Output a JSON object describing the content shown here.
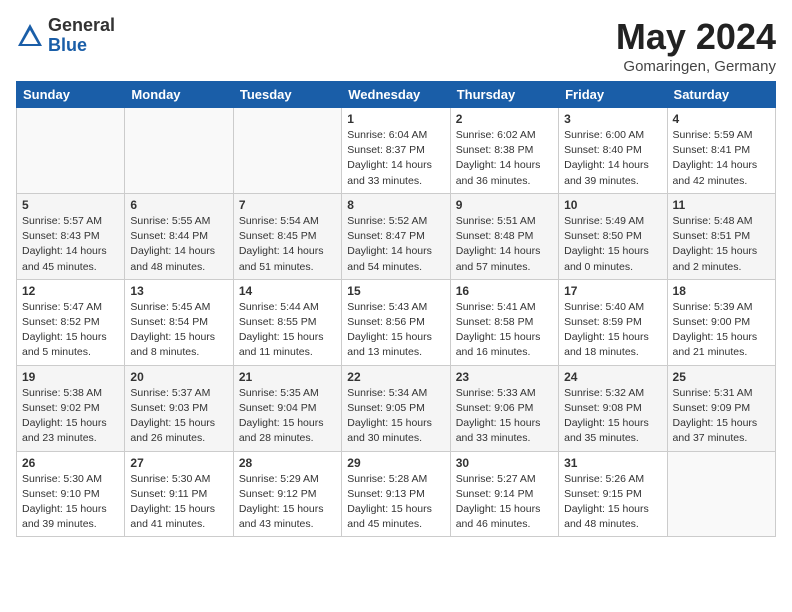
{
  "logo": {
    "general": "General",
    "blue": "Blue"
  },
  "title": "May 2024",
  "subtitle": "Gomaringen, Germany",
  "weekdays": [
    "Sunday",
    "Monday",
    "Tuesday",
    "Wednesday",
    "Thursday",
    "Friday",
    "Saturday"
  ],
  "weeks": [
    [
      {
        "day": "",
        "info": ""
      },
      {
        "day": "",
        "info": ""
      },
      {
        "day": "",
        "info": ""
      },
      {
        "day": "1",
        "info": "Sunrise: 6:04 AM\nSunset: 8:37 PM\nDaylight: 14 hours\nand 33 minutes."
      },
      {
        "day": "2",
        "info": "Sunrise: 6:02 AM\nSunset: 8:38 PM\nDaylight: 14 hours\nand 36 minutes."
      },
      {
        "day": "3",
        "info": "Sunrise: 6:00 AM\nSunset: 8:40 PM\nDaylight: 14 hours\nand 39 minutes."
      },
      {
        "day": "4",
        "info": "Sunrise: 5:59 AM\nSunset: 8:41 PM\nDaylight: 14 hours\nand 42 minutes."
      }
    ],
    [
      {
        "day": "5",
        "info": "Sunrise: 5:57 AM\nSunset: 8:43 PM\nDaylight: 14 hours\nand 45 minutes."
      },
      {
        "day": "6",
        "info": "Sunrise: 5:55 AM\nSunset: 8:44 PM\nDaylight: 14 hours\nand 48 minutes."
      },
      {
        "day": "7",
        "info": "Sunrise: 5:54 AM\nSunset: 8:45 PM\nDaylight: 14 hours\nand 51 minutes."
      },
      {
        "day": "8",
        "info": "Sunrise: 5:52 AM\nSunset: 8:47 PM\nDaylight: 14 hours\nand 54 minutes."
      },
      {
        "day": "9",
        "info": "Sunrise: 5:51 AM\nSunset: 8:48 PM\nDaylight: 14 hours\nand 57 minutes."
      },
      {
        "day": "10",
        "info": "Sunrise: 5:49 AM\nSunset: 8:50 PM\nDaylight: 15 hours\nand 0 minutes."
      },
      {
        "day": "11",
        "info": "Sunrise: 5:48 AM\nSunset: 8:51 PM\nDaylight: 15 hours\nand 2 minutes."
      }
    ],
    [
      {
        "day": "12",
        "info": "Sunrise: 5:47 AM\nSunset: 8:52 PM\nDaylight: 15 hours\nand 5 minutes."
      },
      {
        "day": "13",
        "info": "Sunrise: 5:45 AM\nSunset: 8:54 PM\nDaylight: 15 hours\nand 8 minutes."
      },
      {
        "day": "14",
        "info": "Sunrise: 5:44 AM\nSunset: 8:55 PM\nDaylight: 15 hours\nand 11 minutes."
      },
      {
        "day": "15",
        "info": "Sunrise: 5:43 AM\nSunset: 8:56 PM\nDaylight: 15 hours\nand 13 minutes."
      },
      {
        "day": "16",
        "info": "Sunrise: 5:41 AM\nSunset: 8:58 PM\nDaylight: 15 hours\nand 16 minutes."
      },
      {
        "day": "17",
        "info": "Sunrise: 5:40 AM\nSunset: 8:59 PM\nDaylight: 15 hours\nand 18 minutes."
      },
      {
        "day": "18",
        "info": "Sunrise: 5:39 AM\nSunset: 9:00 PM\nDaylight: 15 hours\nand 21 minutes."
      }
    ],
    [
      {
        "day": "19",
        "info": "Sunrise: 5:38 AM\nSunset: 9:02 PM\nDaylight: 15 hours\nand 23 minutes."
      },
      {
        "day": "20",
        "info": "Sunrise: 5:37 AM\nSunset: 9:03 PM\nDaylight: 15 hours\nand 26 minutes."
      },
      {
        "day": "21",
        "info": "Sunrise: 5:35 AM\nSunset: 9:04 PM\nDaylight: 15 hours\nand 28 minutes."
      },
      {
        "day": "22",
        "info": "Sunrise: 5:34 AM\nSunset: 9:05 PM\nDaylight: 15 hours\nand 30 minutes."
      },
      {
        "day": "23",
        "info": "Sunrise: 5:33 AM\nSunset: 9:06 PM\nDaylight: 15 hours\nand 33 minutes."
      },
      {
        "day": "24",
        "info": "Sunrise: 5:32 AM\nSunset: 9:08 PM\nDaylight: 15 hours\nand 35 minutes."
      },
      {
        "day": "25",
        "info": "Sunrise: 5:31 AM\nSunset: 9:09 PM\nDaylight: 15 hours\nand 37 minutes."
      }
    ],
    [
      {
        "day": "26",
        "info": "Sunrise: 5:30 AM\nSunset: 9:10 PM\nDaylight: 15 hours\nand 39 minutes."
      },
      {
        "day": "27",
        "info": "Sunrise: 5:30 AM\nSunset: 9:11 PM\nDaylight: 15 hours\nand 41 minutes."
      },
      {
        "day": "28",
        "info": "Sunrise: 5:29 AM\nSunset: 9:12 PM\nDaylight: 15 hours\nand 43 minutes."
      },
      {
        "day": "29",
        "info": "Sunrise: 5:28 AM\nSunset: 9:13 PM\nDaylight: 15 hours\nand 45 minutes."
      },
      {
        "day": "30",
        "info": "Sunrise: 5:27 AM\nSunset: 9:14 PM\nDaylight: 15 hours\nand 46 minutes."
      },
      {
        "day": "31",
        "info": "Sunrise: 5:26 AM\nSunset: 9:15 PM\nDaylight: 15 hours\nand 48 minutes."
      },
      {
        "day": "",
        "info": ""
      }
    ]
  ]
}
